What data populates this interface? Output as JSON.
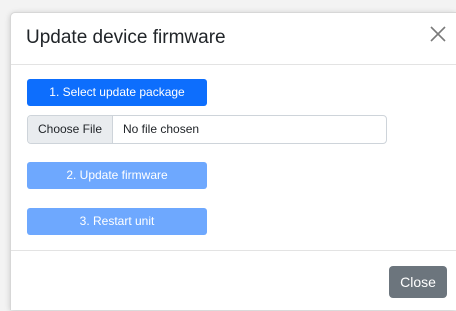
{
  "dialog": {
    "title": "Update device firmware",
    "close_icon": "close-icon"
  },
  "steps": {
    "select_package_label": "1. Select update package",
    "update_firmware_label": "2. Update firmware",
    "restart_unit_label": "3. Restart unit"
  },
  "file_input": {
    "button_label": "Choose File",
    "status_text": "No file chosen"
  },
  "footer": {
    "close_label": "Close"
  },
  "colors": {
    "primary": "#0d6efd",
    "primary_disabled": "#6ea8fe",
    "secondary": "#6c757d"
  }
}
